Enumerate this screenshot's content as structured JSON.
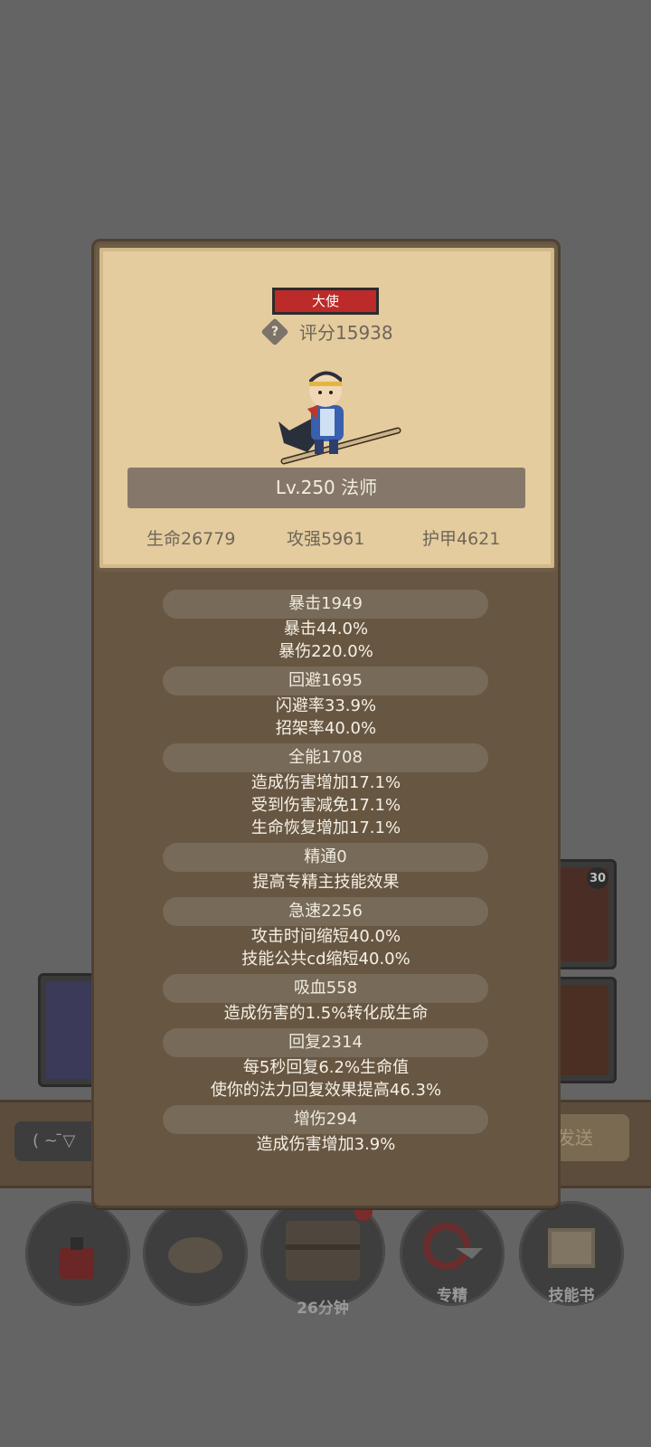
{
  "popup": {
    "title_badge": "大使",
    "score_label": "评分15938",
    "level_line": "Lv.250 法师",
    "base_stats": [
      "生命26779",
      "攻强5961",
      "护甲4621"
    ],
    "sections": [
      {
        "heading": "暴击1949",
        "lines": [
          "暴击44.0%",
          "暴伤220.0%"
        ]
      },
      {
        "heading": "回避1695",
        "lines": [
          "闪避率33.9%",
          "招架率40.0%"
        ]
      },
      {
        "heading": "全能1708",
        "lines": [
          "造成伤害增加17.1%",
          "受到伤害减免17.1%",
          "生命恢复增加17.1%"
        ]
      },
      {
        "heading": "精通0",
        "lines": [
          "提高专精主技能效果"
        ]
      },
      {
        "heading": "急速2256",
        "lines": [
          "攻击时间缩短40.0%",
          "技能公共cd缩短40.0%"
        ]
      },
      {
        "heading": "吸血558",
        "lines": [
          "造成伤害的1.5%转化成生命"
        ]
      },
      {
        "heading": "回复2314",
        "lines": [
          "每5秒回复6.2%生命值",
          "使你的法力回复效果提高46.3%"
        ]
      },
      {
        "heading": "增伤294",
        "lines": [
          "造成伤害增加3.9%"
        ]
      }
    ]
  },
  "background": {
    "skill_card_badge": "30",
    "chat_input_text": "( ~ ̄▽",
    "send_button": "发送",
    "bottom_nav": [
      {
        "label": "",
        "icon": "potion-icon"
      },
      {
        "label": "",
        "icon": "bread-icon"
      },
      {
        "label": "26分钟",
        "icon": "treasure-chest-icon"
      },
      {
        "label": "专精",
        "icon": "specialization-icon"
      },
      {
        "label": "技能书",
        "icon": "skill-book-icon"
      }
    ]
  },
  "colors": {
    "badge_red": "#bc2a29",
    "panel_parchment": "#e4cc9f",
    "popup_brown": "#675742"
  }
}
